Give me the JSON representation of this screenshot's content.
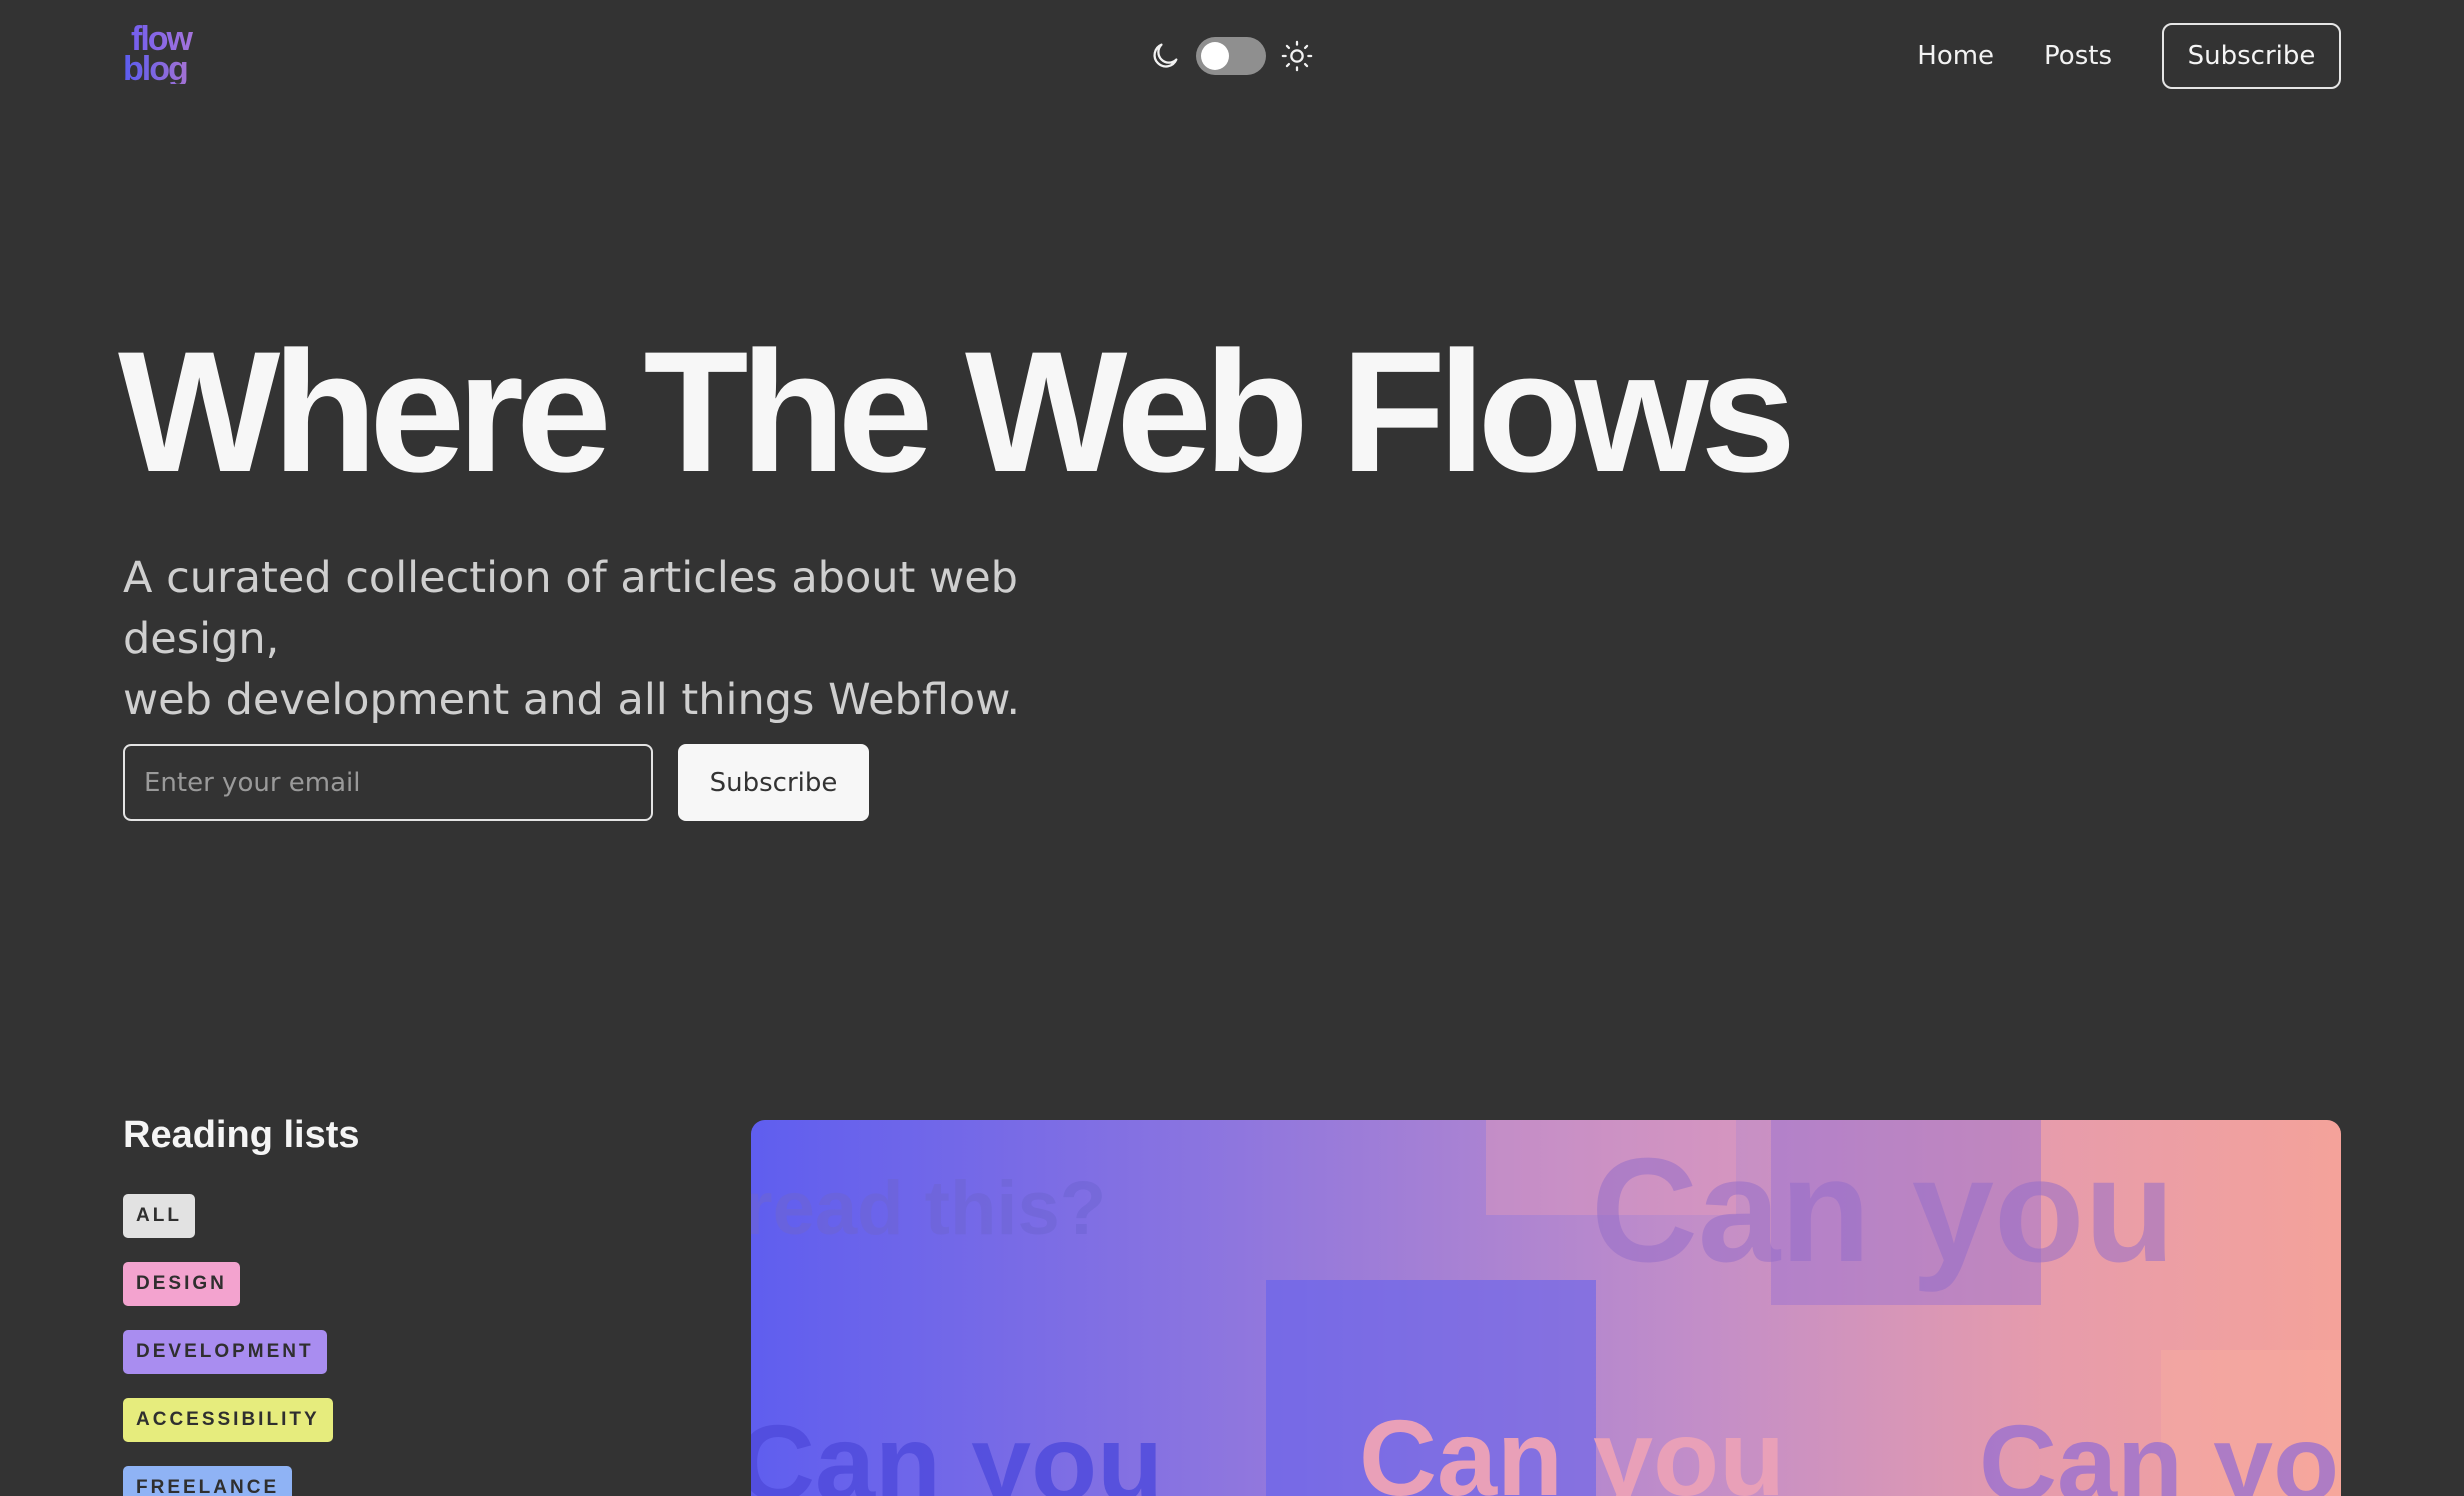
{
  "header": {
    "logo": {
      "line1": "flow",
      "line2": "blog"
    },
    "theme_toggle": {
      "dark_icon": "moon-icon",
      "light_icon": "sun-icon",
      "state": "dark"
    },
    "nav": {
      "home": "Home",
      "posts": "Posts",
      "subscribe": "Subscribe"
    }
  },
  "hero": {
    "title": "Where The Web Flows",
    "subtitle_line1": "A curated collection of articles about web design,",
    "subtitle_line2": "web development and all things Webflow.",
    "email_placeholder": "Enter your email",
    "subscribe_label": "Subscribe"
  },
  "reading_lists": {
    "title": "Reading lists",
    "tags": [
      {
        "label": "ALL",
        "color": "#e2e2e2"
      },
      {
        "label": "DESIGN",
        "color": "#f3a3cf"
      },
      {
        "label": "DEVELOPMENT",
        "color": "#a98df0"
      },
      {
        "label": "ACCESSIBILITY",
        "color": "#e6ec7d"
      },
      {
        "label": "FREELANCE",
        "color": "#8fb3f5"
      }
    ]
  },
  "featured_card": {
    "text_top_left": "read this?",
    "text_top_right": "Can you",
    "text_bottom_left": "Can you",
    "text_bottom_center": "Can you",
    "text_bottom_right": "Can yo"
  },
  "colors": {
    "background": "#333333",
    "text": "#f5f5f5",
    "subtitle": "#cfcfcf",
    "accent_blue": "#5f5eef",
    "accent_salmon": "#f4a29a"
  }
}
